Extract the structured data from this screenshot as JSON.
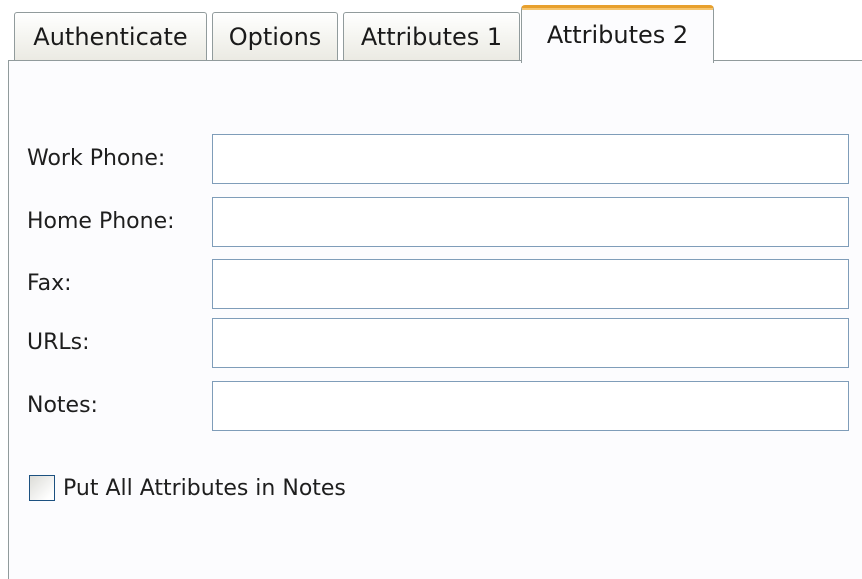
{
  "tabs": [
    {
      "label": "Authenticate",
      "selected": false
    },
    {
      "label": "Options",
      "selected": false
    },
    {
      "label": "Attributes 1",
      "selected": false
    },
    {
      "label": "Attributes 2",
      "selected": true
    }
  ],
  "fields": {
    "work_phone": {
      "label": "Work Phone:",
      "value": ""
    },
    "home_phone": {
      "label": "Home Phone:",
      "value": ""
    },
    "fax": {
      "label": "Fax:",
      "value": ""
    },
    "urls": {
      "label": "URLs:",
      "value": ""
    },
    "notes": {
      "label": "Notes:",
      "value": ""
    }
  },
  "put_all_attributes": {
    "label": "Put All Attributes in Notes",
    "checked": false
  },
  "colors": {
    "active_tab_accent": "#e8a02c",
    "field_border": "#7f9db9",
    "checkbox_border": "#1c5180",
    "tab_border": "#919b9c"
  }
}
